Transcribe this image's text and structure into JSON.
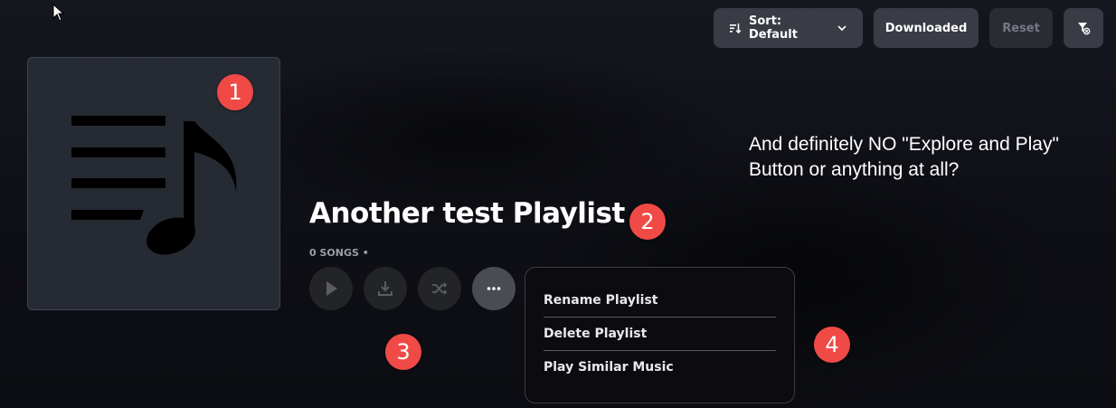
{
  "toolbar": {
    "sort_label": "Sort: Default",
    "downloaded_label": "Downloaded",
    "reset_label": "Reset"
  },
  "playlist": {
    "title": "Another test Playlist",
    "meta": "0 SONGS •"
  },
  "menu": {
    "items": [
      "Rename Playlist",
      "Delete Playlist",
      "Play Similar Music"
    ]
  },
  "annotations": {
    "markers": [
      "1",
      "2",
      "3",
      "4"
    ],
    "note": "And definitely NO \"Explore and Play\" Button or anything at all?"
  },
  "icons": {
    "sort": "sort-icon",
    "chevron": "chevron-down-icon",
    "filter": "filter-reset-icon",
    "cover": "playlist-music-note-icon",
    "play": "play-icon",
    "download": "download-icon",
    "shuffle": "shuffle-icon",
    "more": "more-horizontal-icon"
  },
  "colors": {
    "background": "#0f1016",
    "button": "#393b45",
    "marker": "#f04a47"
  }
}
